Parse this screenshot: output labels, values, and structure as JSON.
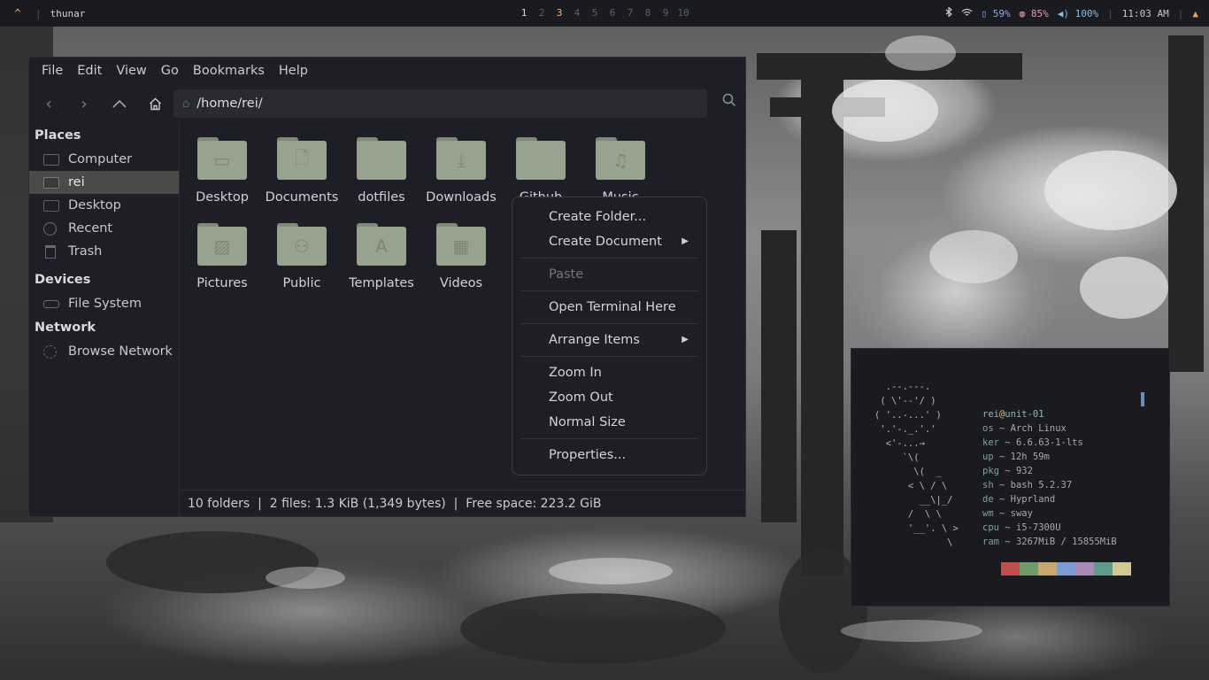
{
  "topbar": {
    "logo": "^",
    "window_title": "thunar",
    "workspaces": [
      "1",
      "2",
      "3",
      "4",
      "5",
      "6",
      "7",
      "8",
      "9",
      "10"
    ],
    "active_workspace": "3",
    "bluetooth_icon": "bluetooth-icon",
    "wifi_icon": "wifi-icon",
    "battery": "59%",
    "memory": "85%",
    "volume": "100%",
    "clock": "11:03 AM",
    "notification_icon": "bell-icon",
    "colors": {
      "background": "#1a1b21",
      "accent": "#e5a95c"
    }
  },
  "thunar": {
    "menu": [
      "File",
      "Edit",
      "View",
      "Go",
      "Bookmarks",
      "Help"
    ],
    "path": "/home/rei/",
    "sidebar": {
      "places_heading": "Places",
      "places": [
        {
          "label": "Computer",
          "icon": "computer-icon"
        },
        {
          "label": "rei",
          "icon": "home-folder-icon",
          "selected": true
        },
        {
          "label": "Desktop",
          "icon": "desktop-icon"
        },
        {
          "label": "Recent",
          "icon": "clock-icon"
        },
        {
          "label": "Trash",
          "icon": "trash-icon"
        }
      ],
      "devices_heading": "Devices",
      "devices": [
        {
          "label": "File System",
          "icon": "drive-icon"
        }
      ],
      "network_heading": "Network",
      "network": [
        {
          "label": "Browse Network",
          "icon": "network-icon"
        }
      ]
    },
    "files": [
      {
        "name": "Desktop",
        "glyph": "▭"
      },
      {
        "name": "Documents",
        "glyph": "🗋"
      },
      {
        "name": "dotfiles",
        "glyph": ""
      },
      {
        "name": "Downloads",
        "glyph": "⤓"
      },
      {
        "name": "Github",
        "glyph": ""
      },
      {
        "name": "Music",
        "glyph": "♫"
      },
      {
        "name": "Pictures",
        "glyph": "▨"
      },
      {
        "name": "Public",
        "glyph": "⚇"
      },
      {
        "name": "Templates",
        "glyph": "A"
      },
      {
        "name": "Videos",
        "glyph": "▦"
      }
    ],
    "statusbar": "10 folders  |  2 files: 1.3 KiB (1,349 bytes)  |  Free space: 223.2 GiB"
  },
  "context_menu": {
    "create_folder": "Create Folder...",
    "create_document": "Create Document",
    "paste": "Paste",
    "open_terminal": "Open Terminal Here",
    "arrange_items": "Arrange Items",
    "zoom_in": "Zoom In",
    "zoom_out": "Zoom Out",
    "normal_size": "Normal Size",
    "properties": "Properties..."
  },
  "terminal": {
    "ascii_art": "  .--.---.\n ( \\'--'/ )\n( '..-...' )\n '.'-._.'.'\n  <'-...→\n     `\\(\n       \\(  _\n      < \\ / \\\n        __\\|_/\n      /  \\ \\\n      '__'. \\ >\n             \\",
    "user": "rei",
    "host": "unit-01",
    "fetch": [
      {
        "key": "os",
        "value": "Arch Linux"
      },
      {
        "key": "ker",
        "value": "6.6.63-1-lts"
      },
      {
        "key": "up",
        "value": "12h 59m"
      },
      {
        "key": "pkg",
        "value": "932"
      },
      {
        "key": "sh",
        "value": "bash 5.2.37"
      },
      {
        "key": "de",
        "value": "Hyprland"
      },
      {
        "key": "wm",
        "value": "sway"
      },
      {
        "key": "cpu",
        "value": "i5-7300U"
      },
      {
        "key": "ram",
        "value": "3267MiB / 15855MiB"
      }
    ],
    "palette": [
      "#c24d4d",
      "#6f9a6c",
      "#c9a870",
      "#7d9cd4",
      "#a98ab6",
      "#5f9a8a",
      "#d1c895"
    ]
  }
}
